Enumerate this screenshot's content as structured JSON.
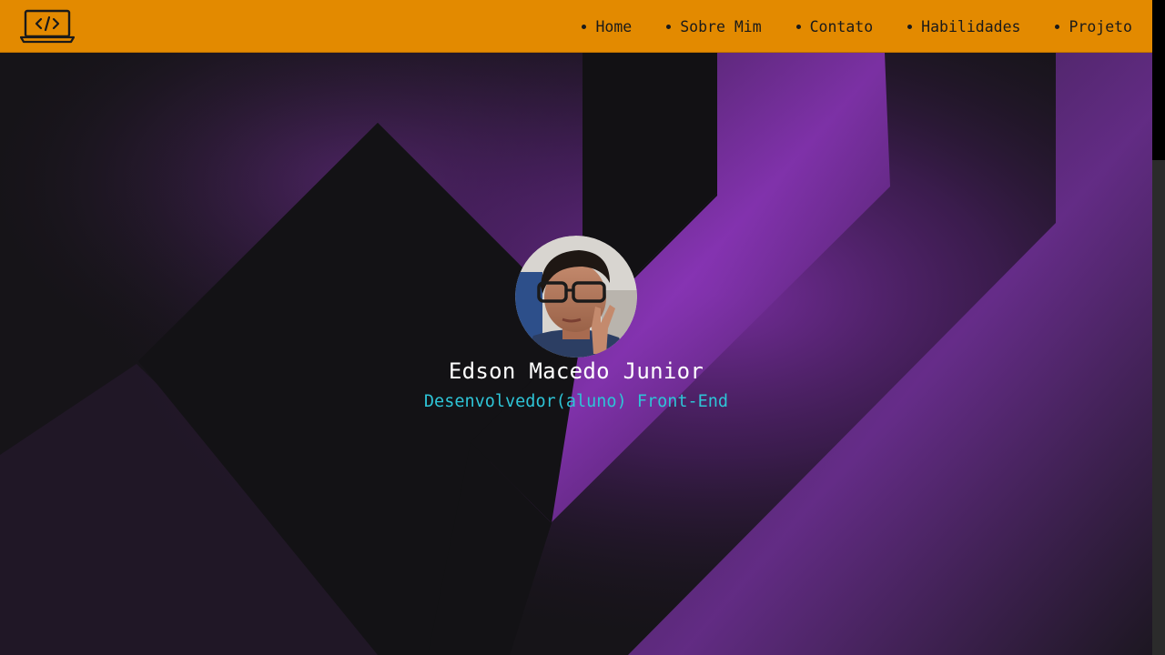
{
  "nav": {
    "logo_icon": "laptop-code-icon",
    "items": [
      {
        "label": "Home"
      },
      {
        "label": "Sobre Mim"
      },
      {
        "label": "Contato"
      },
      {
        "label": "Habilidades"
      },
      {
        "label": "Projeto"
      }
    ]
  },
  "hero": {
    "name": "Edson Macedo Junior",
    "role": "Desenvolvedor(aluno) Front-End",
    "avatar_icon": "profile-photo"
  },
  "colors": {
    "navbar": "#e38a00",
    "background": "#141316",
    "accent_purple": "#8a3fb8",
    "role_text": "#2ec4d6",
    "name_text": "#ffffff"
  }
}
